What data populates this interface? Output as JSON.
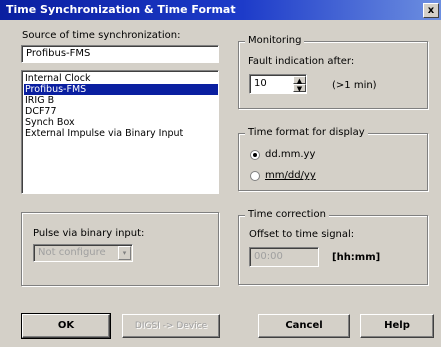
{
  "window": {
    "title": "Time Synchronization & Time Format",
    "close_glyph": "x"
  },
  "source": {
    "label": "Source of time synchronization:",
    "value": "Profibus-FMS",
    "options": [
      "Internal Clock",
      "Profibus-FMS",
      "IRIG B",
      "DCF77",
      "Synch Box",
      "External Impulse via Binary Input"
    ],
    "selected_index": 1
  },
  "pulse": {
    "label": "Pulse via binary input:",
    "value": "Not configure",
    "dropdown_glyph": "▾"
  },
  "monitoring": {
    "group_title": "Monitoring",
    "fault_label": "Fault indication after:",
    "value": "10",
    "unit": "(>1 min)",
    "spin_up": "▲",
    "spin_down": "▼"
  },
  "time_format": {
    "group_title": "Time format for display",
    "options": [
      "dd.mm.yy",
      "mm/dd/yy"
    ],
    "selected_index": 0
  },
  "correction": {
    "group_title": "Time correction",
    "offset_label": "Offset to time signal:",
    "value": "00:00",
    "unit": "[hh:mm]"
  },
  "buttons": {
    "ok": "OK",
    "device": "DIGSI -> Device",
    "cancel": "Cancel",
    "help": "Help"
  }
}
